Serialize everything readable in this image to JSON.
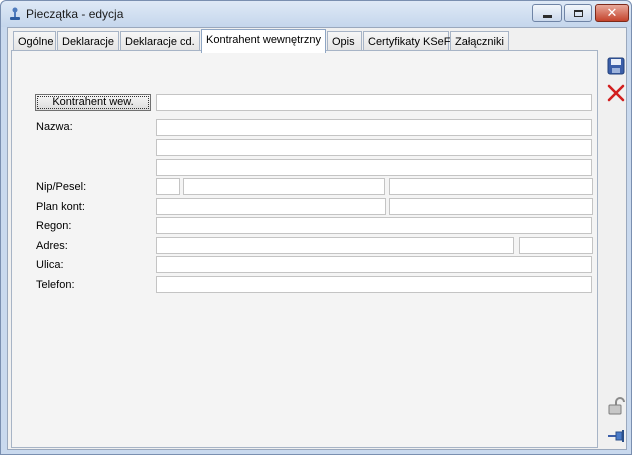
{
  "window": {
    "title": "Pieczątka - edycja",
    "controls": {
      "minimize": "minimize",
      "maximize": "maximize",
      "close": "close"
    }
  },
  "tabs": [
    {
      "label": "Ogólne",
      "active": false
    },
    {
      "label": "Deklaracje",
      "active": false
    },
    {
      "label": "Deklaracje cd.",
      "active": false
    },
    {
      "label": "Kontrahent wewnętrzny",
      "active": true
    },
    {
      "label": "Opis",
      "active": false
    },
    {
      "label": "Certyfikaty KSeF",
      "active": false
    },
    {
      "label": "Załączniki",
      "active": false
    }
  ],
  "form": {
    "kontrahent_button": "Kontrahent wew.",
    "labels": {
      "nazwa": "Nazwa:",
      "nip": "Nip/Pesel:",
      "plan_kont": "Plan kont:",
      "regon": "Regon:",
      "adres": "Adres:",
      "ulica": "Ulica:",
      "telefon": "Telefon:"
    },
    "values": {
      "kontrahent": "",
      "nazwa1": "",
      "nazwa2": "",
      "nazwa3": "",
      "nip_prefix": "",
      "nip": "",
      "pesel": "",
      "plan_kont1": "",
      "plan_kont2": "",
      "regon": "",
      "adres_miasto": "",
      "adres_kod": "",
      "ulica": "",
      "telefon": ""
    }
  },
  "toolbar": {
    "icons": [
      "save-icon",
      "cancel-icon",
      "lock-icon",
      "pin-icon"
    ]
  },
  "colors": {
    "title_bar": "#c9d9ee",
    "close_button": "#c4432c",
    "cancel_icon": "#d21f1f",
    "save_icon": "#3b5ea8"
  }
}
